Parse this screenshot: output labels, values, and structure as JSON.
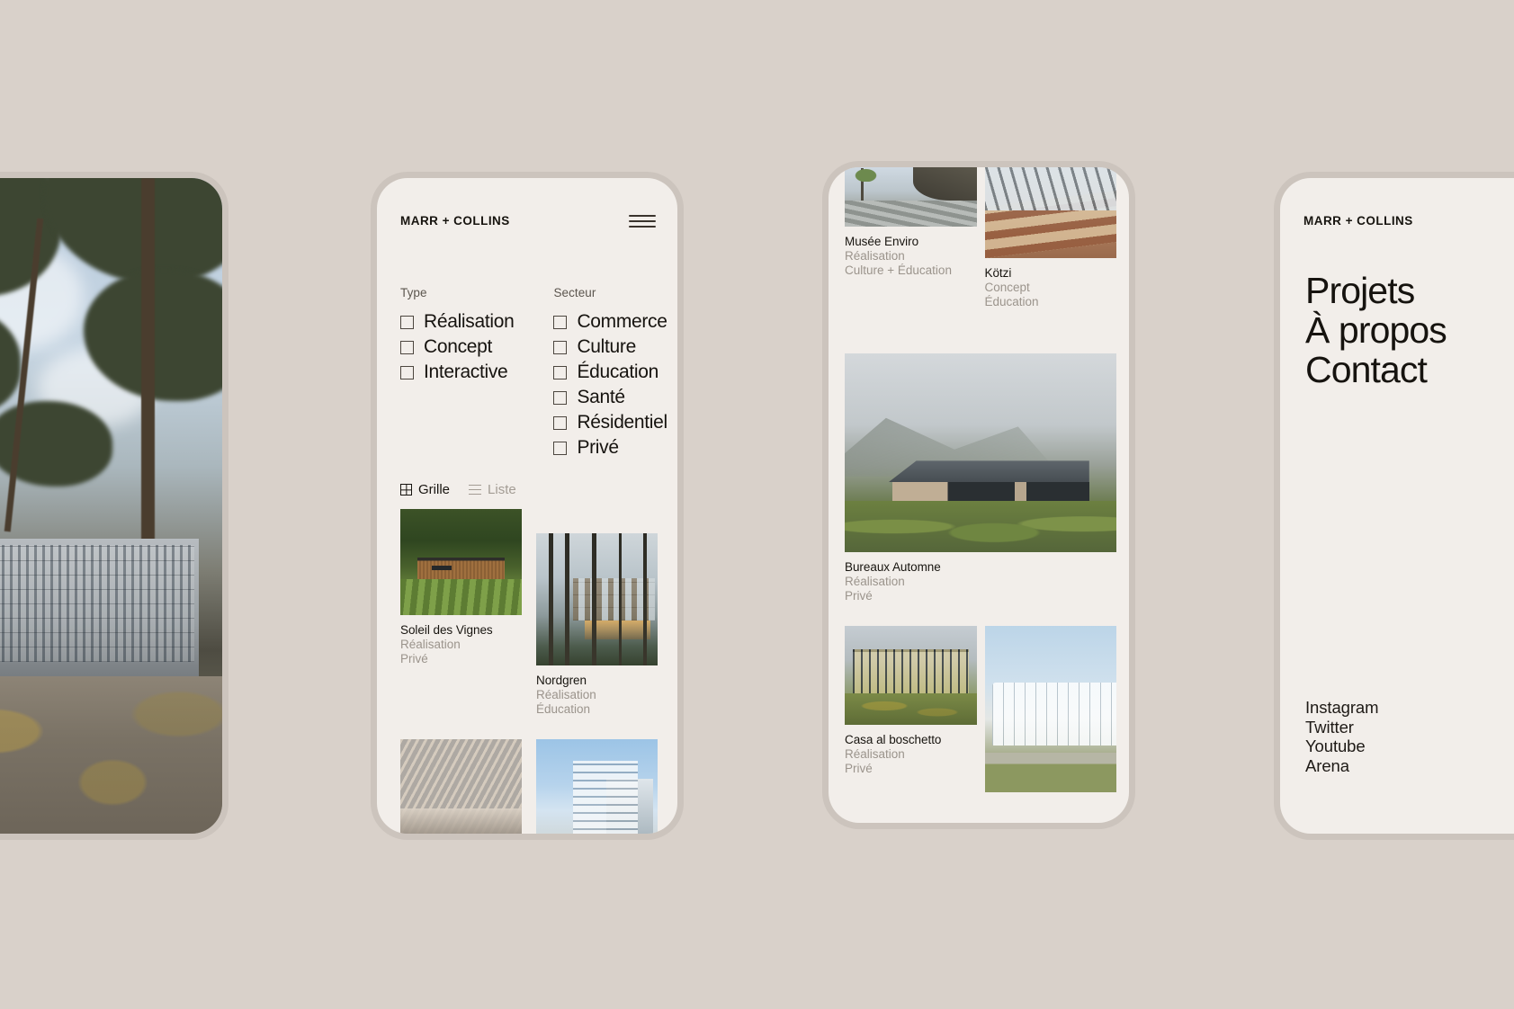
{
  "brand": {
    "wordmark": "MARR + COLLINS"
  },
  "colors": {
    "page_background": "#d9d1ca",
    "screen_background": "#f2eeea",
    "frame": "#ccc4bd",
    "text_primary": "#17140f",
    "text_muted": "#9b948c"
  },
  "menu_icon": "hamburger-icon",
  "filters": {
    "groups": [
      {
        "title": "Type",
        "options": [
          {
            "label": "Réalisation",
            "checked": false
          },
          {
            "label": "Concept",
            "checked": false
          },
          {
            "label": "Interactive",
            "checked": false
          }
        ]
      },
      {
        "title": "Secteur",
        "options": [
          {
            "label": "Commerce",
            "checked": false
          },
          {
            "label": "Culture",
            "checked": false
          },
          {
            "label": "Éducation",
            "checked": false
          },
          {
            "label": "Santé",
            "checked": false
          },
          {
            "label": "Résidentiel",
            "checked": false
          },
          {
            "label": "Privé",
            "checked": false
          }
        ]
      }
    ]
  },
  "view_toggle": {
    "grid": {
      "label": "Grille",
      "icon": "grid-icon",
      "active": true
    },
    "list": {
      "label": "Liste",
      "icon": "list-icon",
      "active": false
    }
  },
  "grid_projects": [
    {
      "title": "Soleil des Vignes",
      "type": "Réalisation",
      "sector": "Privé",
      "image": "vineyard-house"
    },
    {
      "title": "Nordgren",
      "type": "Réalisation",
      "sector": "Éducation",
      "image": "forest-building"
    },
    {
      "title": "",
      "type": "",
      "sector": "",
      "image": "wooden-auditorium"
    },
    {
      "title": "",
      "type": "",
      "sector": "",
      "image": "blue-tower"
    }
  ],
  "feed_projects": [
    {
      "title": "Musée Enviro",
      "type": "Réalisation",
      "sector": "Culture + Éducation",
      "image": "museum-canopy"
    },
    {
      "title": "Kötzi",
      "type": "Concept",
      "sector": "Éducation",
      "image": "atrium-interior"
    },
    {
      "title": "Bureaux Automne",
      "type": "Réalisation",
      "sector": "Privé",
      "image": "highland-house"
    },
    {
      "title": "Casa al boschetto",
      "type": "Réalisation",
      "sector": "Privé",
      "image": "glass-office"
    },
    {
      "title": "",
      "type": "",
      "sector": "",
      "image": "white-pavilion"
    }
  ],
  "menu": {
    "items": [
      "Projets",
      "À propos",
      "Contact"
    ],
    "social": [
      "Instagram",
      "Twitter",
      "Youtube",
      "Arena"
    ]
  }
}
